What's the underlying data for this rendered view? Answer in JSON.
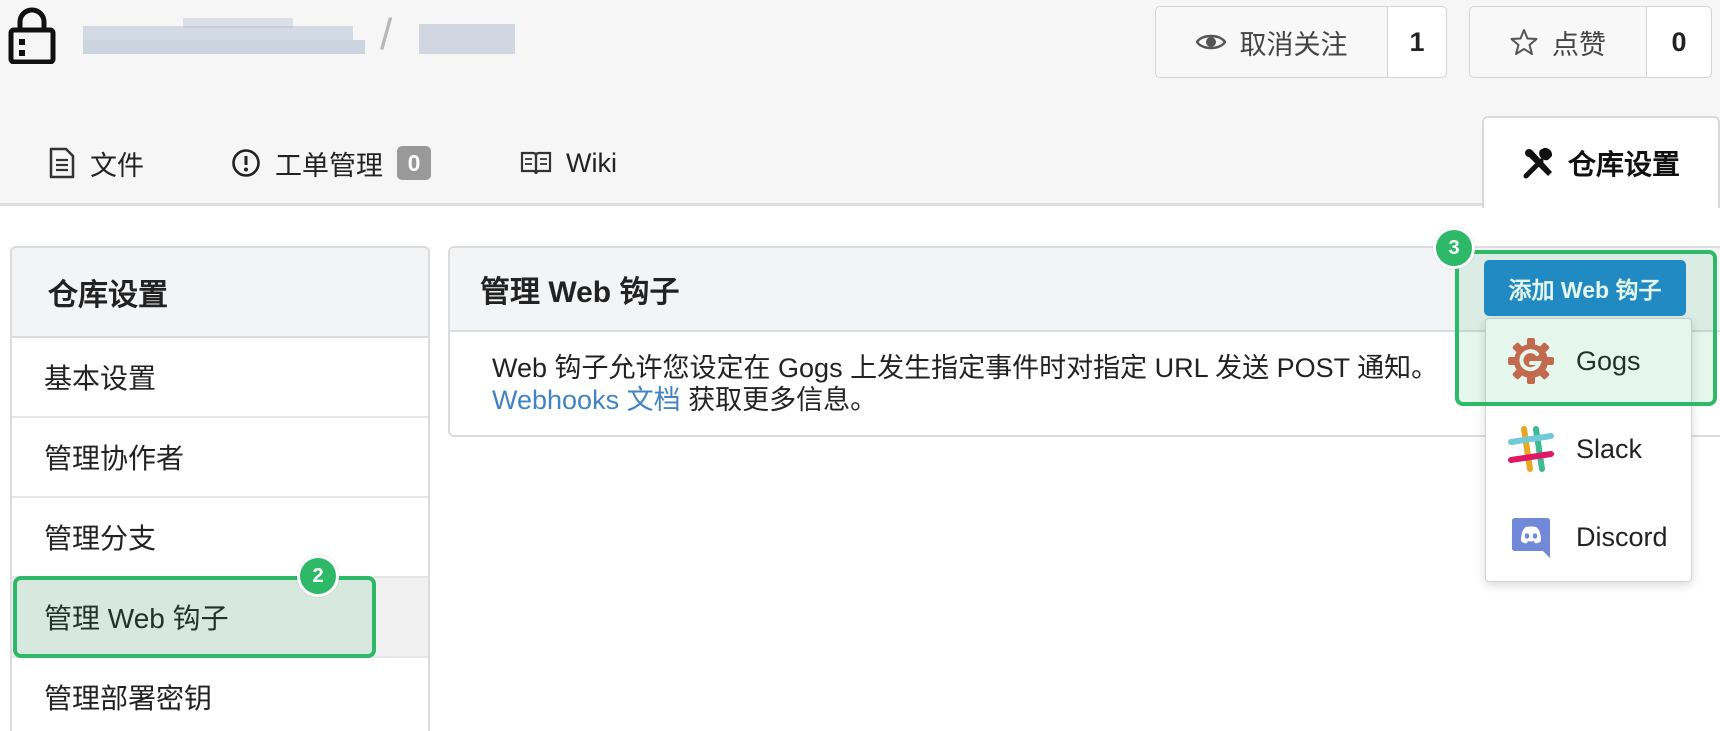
{
  "header": {
    "owner_display": "",
    "path_separator": "/",
    "repo_display": ""
  },
  "actions": {
    "watch": {
      "label": "取消关注",
      "count": "1"
    },
    "star": {
      "label": "点赞",
      "count": "0"
    }
  },
  "tabs": [
    {
      "label": "文件",
      "icon": "file-text-icon"
    },
    {
      "label": "工单管理",
      "icon": "issue-opened-icon",
      "badge": "0"
    },
    {
      "label": "Wiki",
      "icon": "book-icon"
    },
    {
      "label": "仓库设置",
      "icon": "tools-icon",
      "active": true
    }
  ],
  "sidebar": {
    "title": "仓库设置",
    "items": [
      {
        "label": "基本设置"
      },
      {
        "label": "管理协作者"
      },
      {
        "label": "管理分支"
      },
      {
        "label": "管理 Web 钩子",
        "active": true
      },
      {
        "label": "管理部署密钥"
      }
    ]
  },
  "main": {
    "title": "管理 Web 钩子",
    "description_line1": "Web 钩子允许您设定在 Gogs 上发生指定事件时对指定 URL 发送 POST 通知。",
    "docs_link": "Webhooks 文档",
    "description_line2_suffix": " 获取更多信息。",
    "add_button": "添加 Web 钩子",
    "dropdown": [
      {
        "label": "Gogs",
        "icon": "gogs-logo-icon"
      },
      {
        "label": "Slack",
        "icon": "slack-logo-icon"
      },
      {
        "label": "Discord",
        "icon": "discord-logo-icon"
      }
    ]
  },
  "annotations": {
    "step2": "2",
    "step3": "3",
    "highlight_color": "#2db968"
  },
  "colors": {
    "primary": "#2185d0",
    "link": "#4183c4",
    "highlight": "#2db968"
  }
}
